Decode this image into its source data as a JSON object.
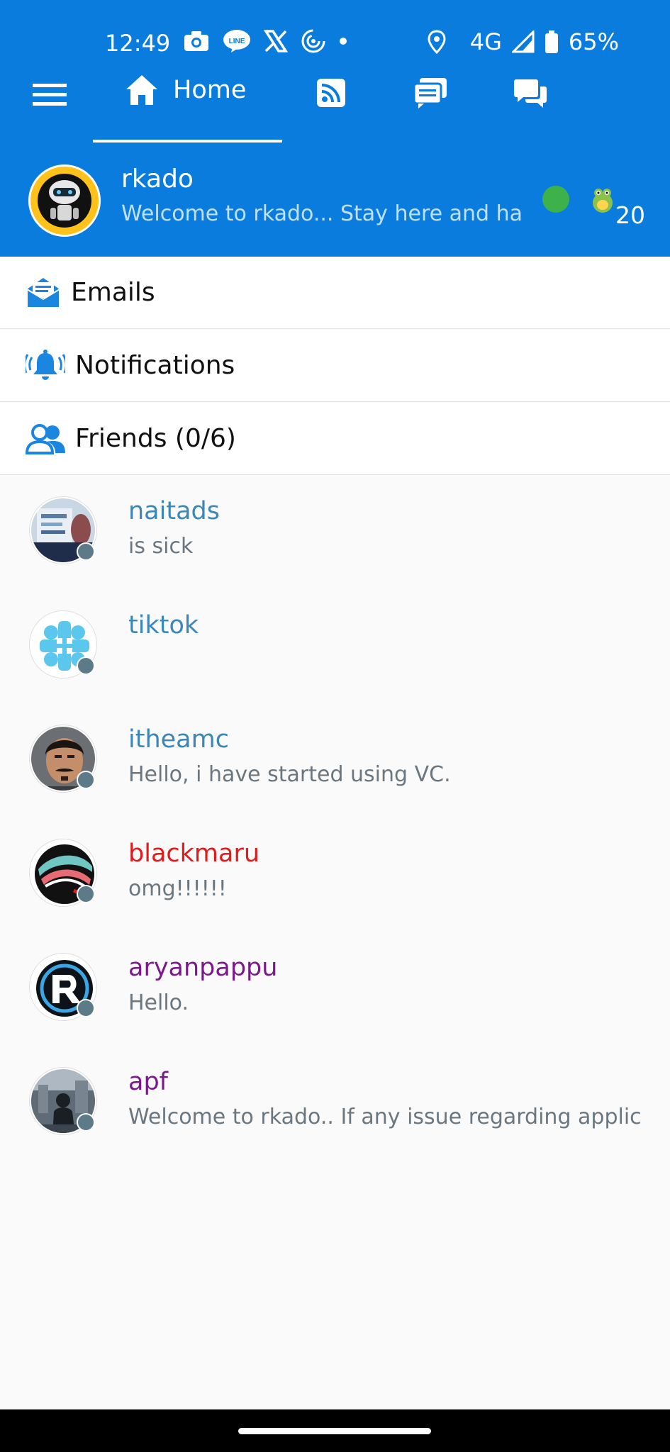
{
  "status_bar": {
    "time": "12:49",
    "network": "4G",
    "battery": "65%",
    "icons": [
      "camera-icon",
      "line-app-icon",
      "x-app-icon",
      "hotspot-icon",
      "location-icon",
      "signal-icon",
      "battery-icon"
    ]
  },
  "tabs": [
    {
      "label": "Home",
      "icon": "home-icon",
      "active": true
    },
    {
      "label": "",
      "icon": "rss-feed-icon",
      "active": false
    },
    {
      "label": "",
      "icon": "chat-rooms-icon",
      "active": false
    },
    {
      "label": "",
      "icon": "messages-icon",
      "active": false
    }
  ],
  "profile": {
    "name": "rkado",
    "status": "Welcome to rkado... Stay here and ha",
    "online": true,
    "coins": "20"
  },
  "menu": [
    {
      "label": "Emails",
      "icon": "email-icon"
    },
    {
      "label": "Notifications",
      "icon": "bell-icon"
    },
    {
      "label": "Friends (0/6)",
      "icon": "friends-icon"
    }
  ],
  "friends": [
    {
      "name": "naitads",
      "message": "is sick",
      "name_color": "#3a87b8"
    },
    {
      "name": "tiktok",
      "message": "",
      "name_color": "#3a87b8"
    },
    {
      "name": "itheamc",
      "message": "Hello, i have started using VC.",
      "name_color": "#3a87b8"
    },
    {
      "name": "blackmaru",
      "message": "omg!!!!!!",
      "name_color": "#e01b1b"
    },
    {
      "name": "aryanpappu",
      "message": "Hello.",
      "name_color": "#7a1a8a"
    },
    {
      "name": "apf",
      "message": "Welcome to rkado.. If any issue regarding applic",
      "name_color": "#7a1a8a"
    }
  ],
  "colors": {
    "header_blue": "#0a7cdd",
    "online_green": "#3db24a",
    "offline_gray": "#5c7a88",
    "icon_blue": "#1a86e0"
  }
}
